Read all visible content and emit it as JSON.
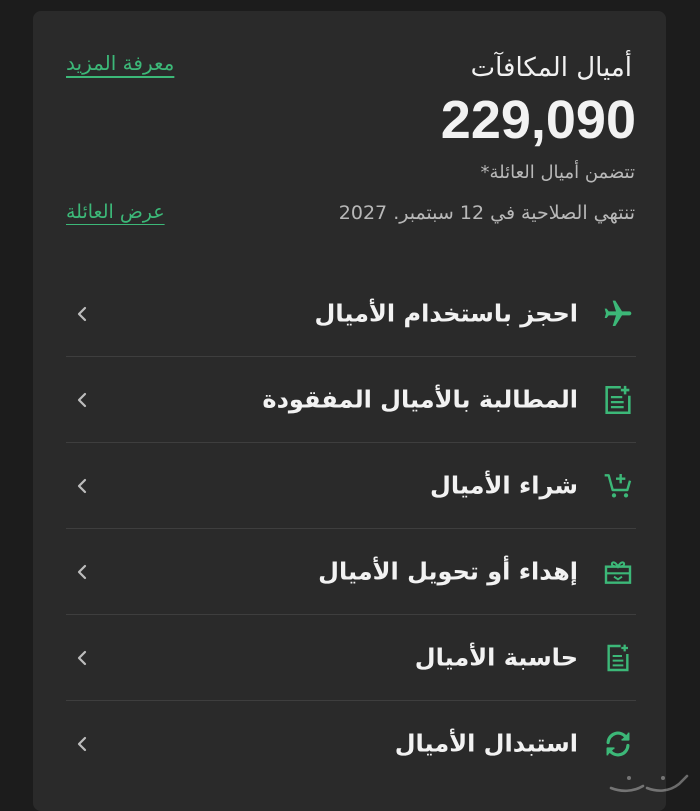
{
  "rewards": {
    "title": "أميال المكافآت",
    "learn_more": "معرفة المزيد",
    "miles": "229,090",
    "family_note": "تتضمن أميال العائلة*",
    "expiry": "تنتهي الصلاحية في  12 سبتمبر. 2027",
    "view_family": "عرض العائلة"
  },
  "menu": [
    {
      "label": "احجز باستخدام الأميال",
      "icon": "airplane-icon"
    },
    {
      "label": "المطالبة بالأميال المفقودة",
      "icon": "claim-document-icon"
    },
    {
      "label": "شراء الأميال",
      "icon": "cart-add-icon"
    },
    {
      "label": "إهداء أو تحويل الأميال",
      "icon": "gift-icon"
    },
    {
      "label": "حاسبة الأميال",
      "icon": "calculator-document-icon"
    },
    {
      "label": "استبدال الأميال",
      "icon": "exchange-arrows-icon"
    }
  ],
  "colors": {
    "accent": "#3cb878",
    "card": "#2a2a2a",
    "background": "#1c1c1c",
    "text": "#f2f2f2",
    "muted": "#b8b8b8"
  }
}
